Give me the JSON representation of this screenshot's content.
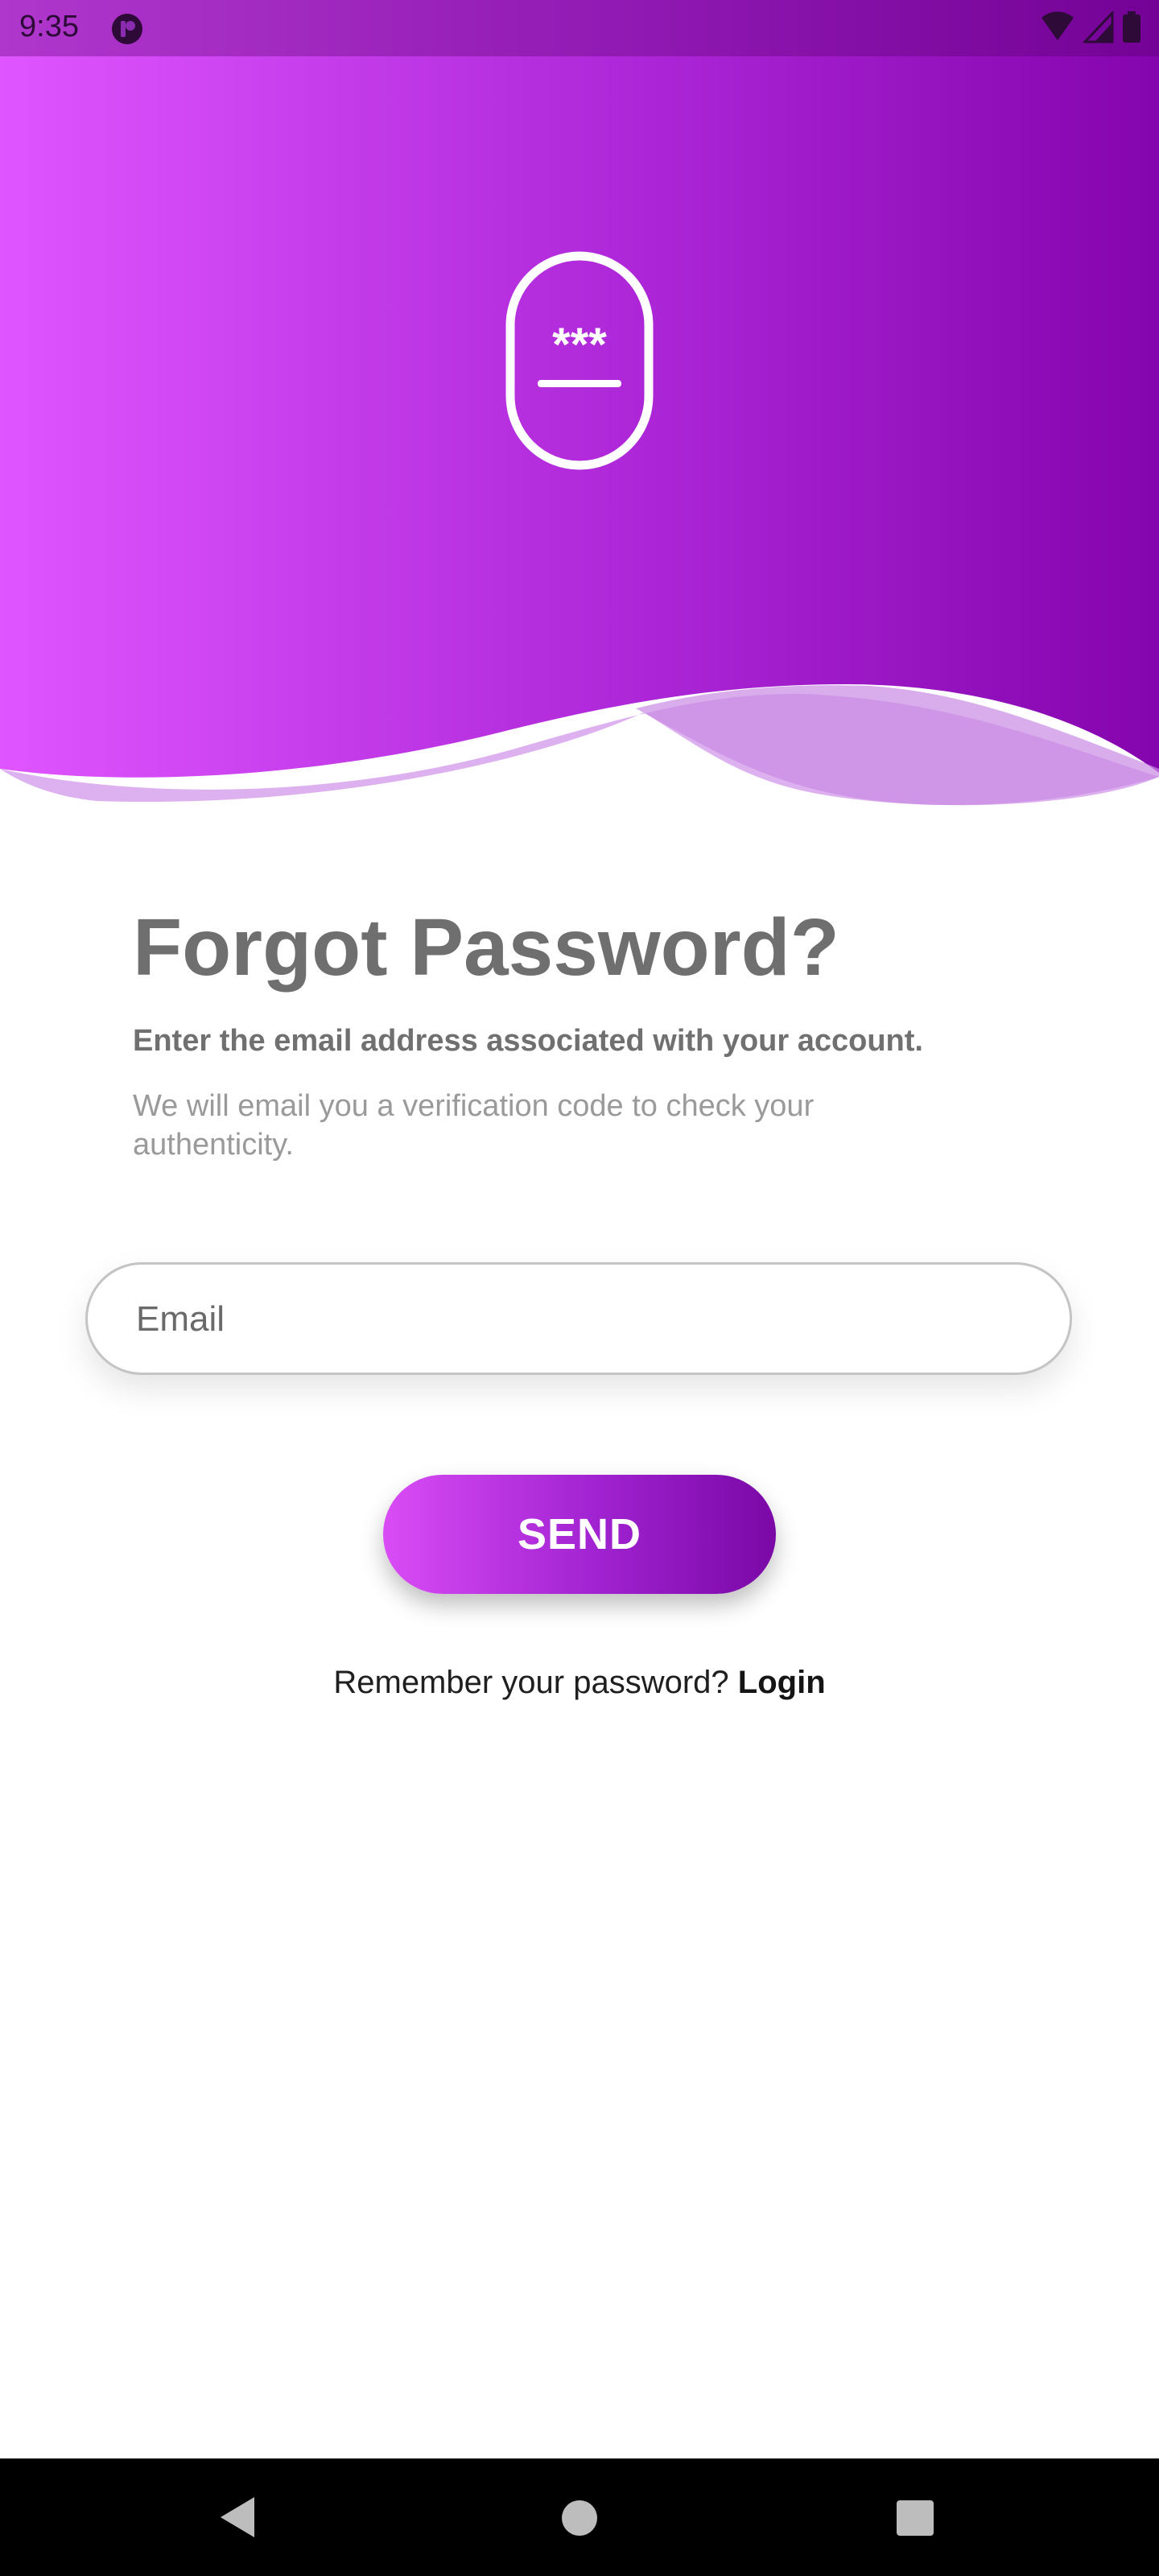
{
  "status_bar": {
    "time": "9:35"
  },
  "hero": {
    "icon": "password-lock-icon",
    "icon_text": "***"
  },
  "content": {
    "title": "Forgot Password?",
    "subtitle": "Enter the email address associated with your account.",
    "description": "We will email you a verification code to check your authenticity."
  },
  "form": {
    "email_placeholder": "Email",
    "email_value": "",
    "send_label": "SEND"
  },
  "footer": {
    "prompt": "Remember your password? ",
    "login_label": "Login"
  },
  "colors": {
    "gradient_start": "#e055ff",
    "gradient_end": "#8a06b0",
    "title": "#6f6f6f"
  }
}
